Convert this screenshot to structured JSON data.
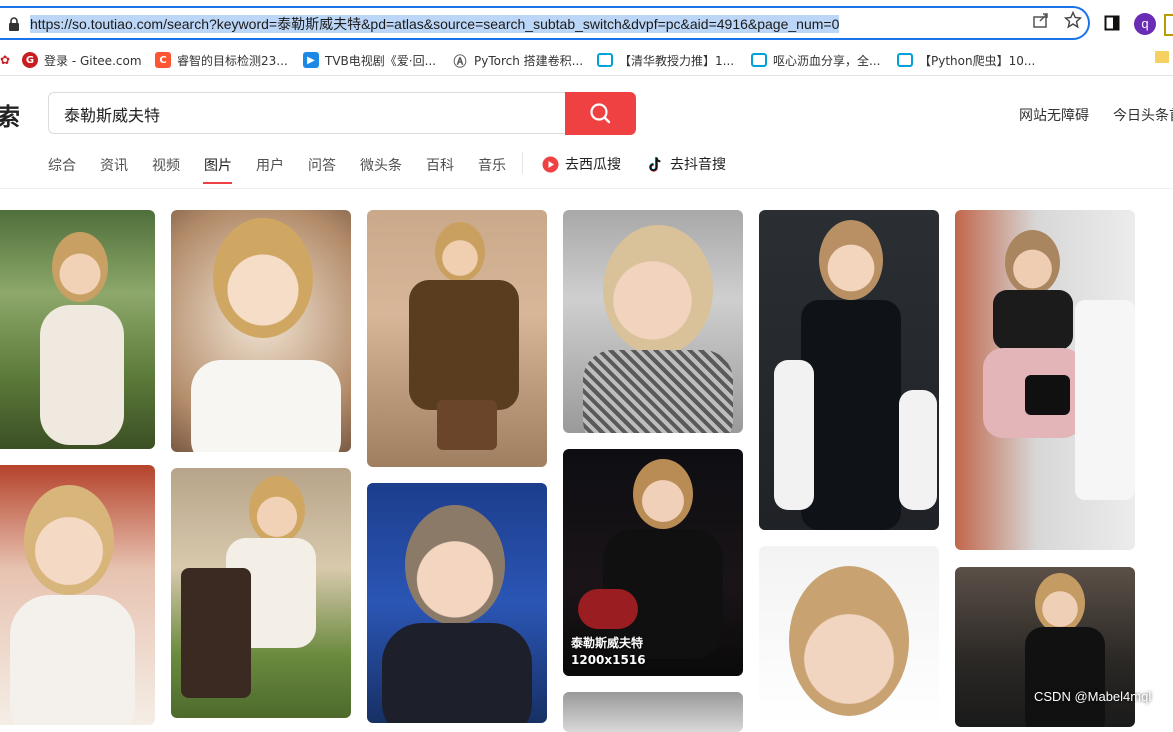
{
  "browser": {
    "url": "https://so.toutiao.com/search?keyword=泰勒斯威夫特&pd=atlas&source=search_subtab_switch&dvpf=pc&aid=4916&page_num=0",
    "profile_initial": "q",
    "bookmarks": [
      {
        "label": "登录 - Gitee.com",
        "icon": "gitee-icon",
        "color": "#c71d23"
      },
      {
        "label": "睿智的目标检测23...",
        "icon": "csdn-icon",
        "color": "#fc5531"
      },
      {
        "label": "TVB电视剧《爱·回...",
        "icon": "video-icon",
        "color": "#1e88e5"
      },
      {
        "label": "PyTorch 搭建卷积...",
        "icon": "pytorch-icon",
        "color": "#555555"
      },
      {
        "label": "【清华教授力推】1...",
        "icon": "bilibili-icon",
        "color": "#00a1d6"
      },
      {
        "label": "呕心沥血分享，全...",
        "icon": "bilibili-icon",
        "color": "#00a1d6"
      },
      {
        "label": "【Python爬虫】10...",
        "icon": "bilibili-icon",
        "color": "#00a1d6"
      }
    ]
  },
  "site": {
    "logo_char": "索",
    "search_value": "泰勒斯威夫特",
    "header_links": [
      "网站无障碍",
      "今日头条首"
    ],
    "tabs": [
      "综合",
      "资讯",
      "视频",
      "图片",
      "用户",
      "问答",
      "微头条",
      "百科",
      "音乐"
    ],
    "active_tab": "图片",
    "external_tabs": [
      {
        "label": "去西瓜搜",
        "icon": "xigua-icon"
      },
      {
        "label": "去抖音搜",
        "icon": "douyin-icon"
      }
    ],
    "hover_caption": {
      "title": "泰勒斯威夫特",
      "size": "1200x1516"
    },
    "watermark": "CSDN @Mabel4mql"
  },
  "colors": {
    "accent": "#f04142",
    "url_highlight": "#bcd6f7",
    "address_border": "#1a73e8"
  }
}
